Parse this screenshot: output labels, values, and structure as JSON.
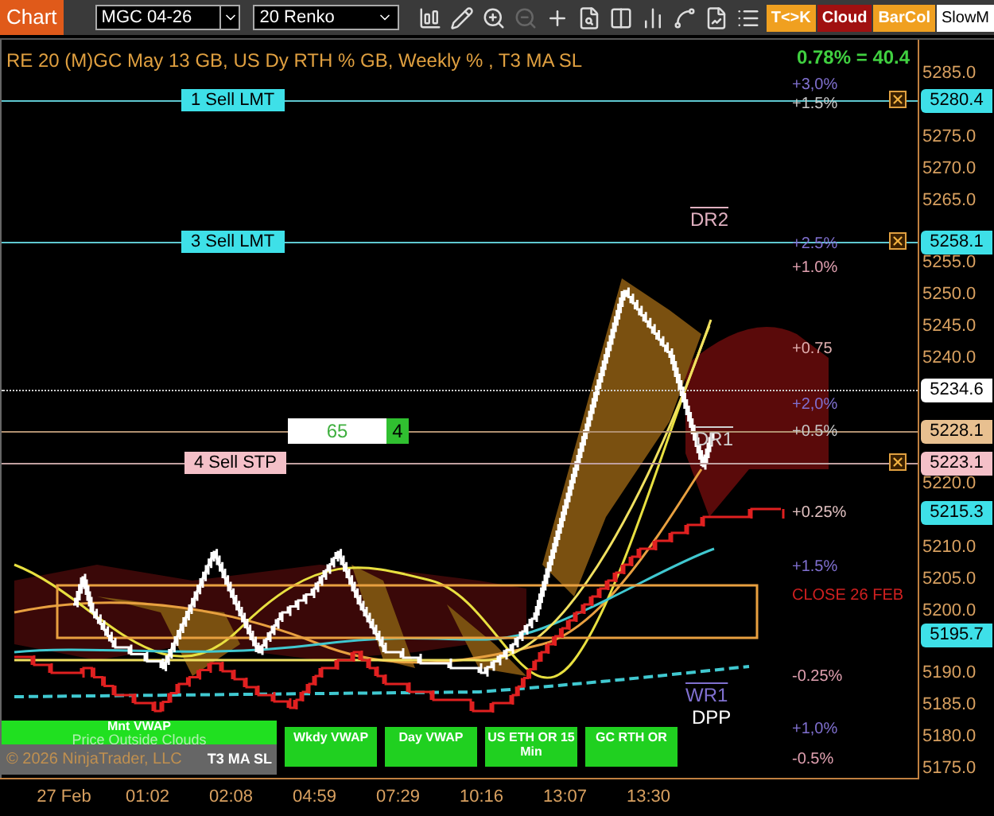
{
  "toolbar": {
    "app_label": "Chart",
    "instrument": "MGC 04-26",
    "interval": "20 Renko",
    "tools": [
      {
        "kind": "bars",
        "disabled": false
      },
      {
        "kind": "draw",
        "disabled": false
      },
      {
        "kind": "zoom_in",
        "disabled": false
      },
      {
        "kind": "zoom_out",
        "disabled": true
      },
      {
        "kind": "crosshair",
        "disabled": false
      },
      {
        "kind": "data",
        "disabled": false
      },
      {
        "kind": "layout",
        "disabled": false
      },
      {
        "kind": "indicators",
        "disabled": false
      },
      {
        "kind": "strategy",
        "disabled": false
      },
      {
        "kind": "properties",
        "disabled": false
      },
      {
        "kind": "list",
        "disabled": false
      }
    ],
    "toggles": [
      {
        "label": "T<>K",
        "color": "#f0a020"
      },
      {
        "label": "Cloud",
        "color": "#a01010"
      },
      {
        "label": "BarCol",
        "color": "#f0a020"
      },
      {
        "label": "SlowM",
        "color": "#ffffff"
      }
    ]
  },
  "chart": {
    "title": "RE 20  (M)GC May 13 GB, US Dy RTH % GB, Weekly % , T3 MA SL",
    "change": "0.78% = 40.4",
    "order_lines": [
      {
        "kind": "limit",
        "label": "1 Sell LMT",
        "price": "5280.4"
      },
      {
        "kind": "limit",
        "label": "3 Sell LMT",
        "price": "5258.1"
      },
      {
        "kind": "last",
        "price": "5234.6"
      },
      {
        "kind": "position",
        "price": "5228.1",
        "pnl": "65",
        "quantity": "4"
      },
      {
        "kind": "stop",
        "label": "4 Sell STP",
        "price": "5223.1"
      },
      {
        "kind": "indicator",
        "price": "5215.3"
      },
      {
        "kind": "indicator",
        "price": "5195.7"
      }
    ],
    "level_labels": [
      {
        "text": "+3,0%",
        "color": "#8070d0"
      },
      {
        "text": "+1.5%",
        "color": "#c8c8c8"
      },
      {
        "text": "+2.5%",
        "color": "#8070d0"
      },
      {
        "text": "+1.0%",
        "color": "#e0a0b0"
      },
      {
        "text": "+0.75",
        "color": "#e0b0b0"
      },
      {
        "text": "+2,0%",
        "color": "#8070d0"
      },
      {
        "text": "+0.5%",
        "color": "#c8c8c8"
      },
      {
        "text": "+0.25%",
        "color": "#e0c0c0"
      },
      {
        "text": "+1.5%",
        "color": "#8070d0"
      },
      {
        "text": "CLOSE 26 FEB",
        "color": "#d02020"
      },
      {
        "text": "-0.25%",
        "color": "#e0a0b0"
      },
      {
        "text": "+1,0%",
        "color": "#8070d0"
      },
      {
        "text": "-0.5%",
        "color": "#e0a0b0"
      }
    ],
    "pivots": [
      {
        "text": "DR2",
        "overline": true,
        "color": "#e0b0c0"
      },
      {
        "text": "DR1",
        "overline": true,
        "color": "#d0d0d0"
      },
      {
        "text": "WR1",
        "overline": true,
        "color": "#8070d0"
      },
      {
        "text": "DPP",
        "overline": false,
        "color": "#ffffff"
      }
    ],
    "price_axis": [
      "5285.0",
      "5275.0",
      "5270.0",
      "5265.0",
      "5255.0",
      "5250.0",
      "5245.0",
      "5240.0",
      "5220.0",
      "5210.0",
      "5205.0",
      "5200.0",
      "5190.0",
      "5185.0",
      "5180.0",
      "5175.0"
    ],
    "panel_buttons": [
      {
        "label": "Mnt VWAP"
      },
      {
        "label": "Wkdy VWAP"
      },
      {
        "label": "Day VWAP"
      },
      {
        "label": "US ETH OR 15 Min"
      },
      {
        "label": "GC RTH OR"
      }
    ],
    "legend": {
      "status": "Price Outside Clouds",
      "copyright": "© 2026 NinjaTrader, LLC",
      "strategy": "T3 MA SL"
    },
    "time_axis": [
      "27 Feb",
      "01:02",
      "02:08",
      "04:59",
      "07:29",
      "10:16",
      "13:07",
      "13:30"
    ]
  }
}
